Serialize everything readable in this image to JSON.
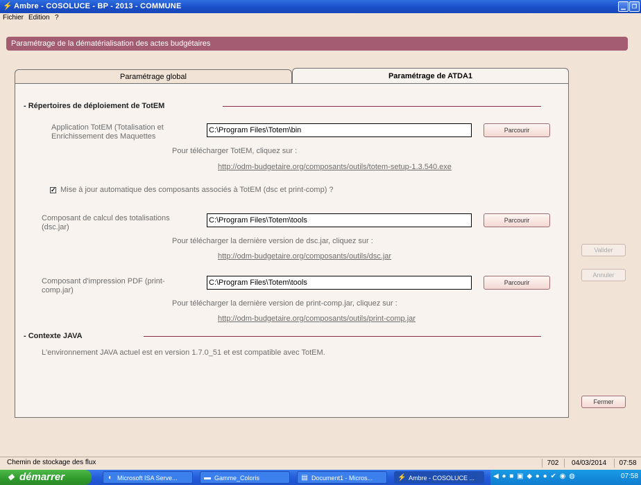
{
  "window": {
    "title": "Ambre - COSOLUCE - BP - 2013 - COMMUNE"
  },
  "menu": {
    "items": [
      "Fichier",
      "Edition",
      "?"
    ]
  },
  "header": {
    "title": "Paramétrage de la dématérialisation des actes budgétaires"
  },
  "tabs": [
    {
      "label": "Paramétrage global",
      "selected": false
    },
    {
      "label": "Paramétrage de ATDA1",
      "selected": true
    }
  ],
  "section_totem": {
    "title": "- Répertoires de déploiement de TotEM",
    "app_label": "Application TotEM (Totalisation et Enrichissement des Maquettes",
    "app_path": "C:\\Program Files\\Totem\\bin",
    "app_download_text": "Pour télécharger TotEM, cliquez sur :",
    "app_link": "http://odm-budgetaire.org/composants/outils/totem-setup-1.3.540.exe",
    "auto_update_label": "Mise à jour automatique des composants associés à TotEM (dsc et print-comp) ?",
    "auto_update_checked": true,
    "dsc_label": "Composant de calcul des totalisations (dsc.jar)",
    "dsc_path": "C:\\Program Files\\Totem\\tools",
    "dsc_download_text": "Pour télécharger la dernière version de dsc.jar, cliquez sur :",
    "dsc_link": "http://odm-budgetaire.org/composants/outils/dsc.jar",
    "print_label": "Composant d'impression PDF (print-comp.jar)",
    "print_path": "C:\\Program Files\\Totem\\tools",
    "print_download_text": "Pour télécharger la dernière version de print-comp.jar, cliquez sur :",
    "print_link": "http://odm-budgetaire.org/composants/outils/print-comp.jar",
    "browse_label": "Parcourir"
  },
  "section_java": {
    "title": "- Contexte JAVA",
    "text": "L'environnement JAVA actuel est en version 1.7.0_51 et est compatible avec TotEM."
  },
  "buttons": {
    "valider": "Valider",
    "annuler": "Annuler",
    "fermer": "Fermer"
  },
  "statusbar": {
    "message": "Chemin de stockage des flux",
    "count": "702",
    "date": "04/03/2014",
    "time": "07:58"
  },
  "taskbar": {
    "start_label": "démarrer",
    "items": [
      {
        "label": "Microsoft ISA Serve..."
      },
      {
        "label": "Gamme_Coloris"
      },
      {
        "label": "Document1 - Micros..."
      },
      {
        "label": "Ambre - COSOLUCE ..."
      }
    ],
    "clock": "07:58"
  },
  "colors": {
    "header_band": "#a35c71",
    "section_line": "#8a2a4a",
    "window_bg": "#f2e3d7",
    "panel_bg": "#f8f3ef"
  }
}
